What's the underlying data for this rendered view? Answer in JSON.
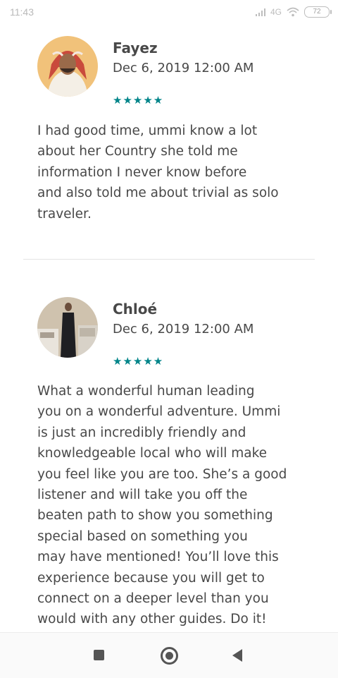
{
  "status_bar": {
    "time": "11:43",
    "network": "4G",
    "battery": "72"
  },
  "reviews": [
    {
      "name": "Fayez",
      "date": "Dec 6, 2019 12:00 AM",
      "rating": 5,
      "stars": "★★★★★",
      "lines": [
        "I had good time, ummi know a lot",
        "about her Country she told me",
        "information I never know before",
        "and also told me about trivial as solo",
        "traveler."
      ]
    },
    {
      "name": "Chloé",
      "date": "Dec 6, 2019 12:00 AM",
      "rating": 5,
      "stars": "★★★★★",
      "lines": [
        "What a wonderful human leading",
        "you on a wonderful adventure. Ummi",
        "is just an incredibly friendly and",
        "knowledgeable local who will make",
        "you feel like you are too. She’s a good",
        "listener and will take you off the",
        "beaten path to show you something",
        "special based on something you",
        "may have mentioned! You’ll love this",
        "experience because you will get to",
        "connect on a deeper level than you",
        "would with any other guides. Do it!"
      ]
    }
  ],
  "colors": {
    "accent": "#008489",
    "text": "#484848"
  }
}
